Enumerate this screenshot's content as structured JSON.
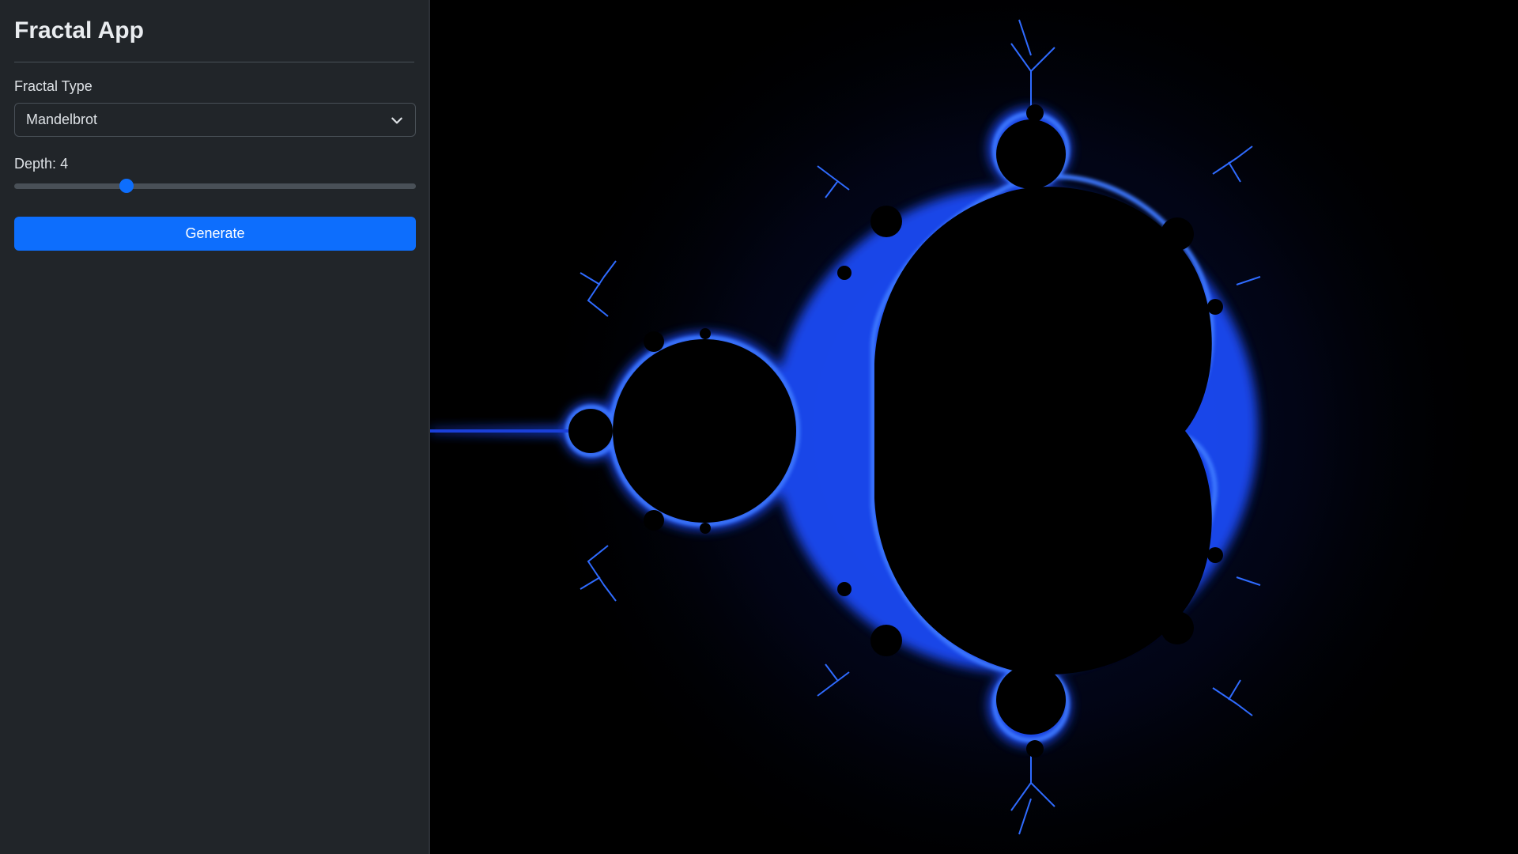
{
  "sidebar": {
    "title": "Fractal App",
    "fractal_type_label": "Fractal Type",
    "fractal_type_value": "Mandelbrot",
    "depth_label": "Depth:",
    "depth_value": 4,
    "depth_fraction": 0.28,
    "generate_label": "Generate"
  },
  "colors": {
    "sidebar_bg": "#212529",
    "accent": "#0d6efd",
    "fractal_glow": "#1e4dff",
    "fractal_fill": "#000000"
  },
  "icons": {
    "select_chevron": "chevron-down-icon"
  }
}
